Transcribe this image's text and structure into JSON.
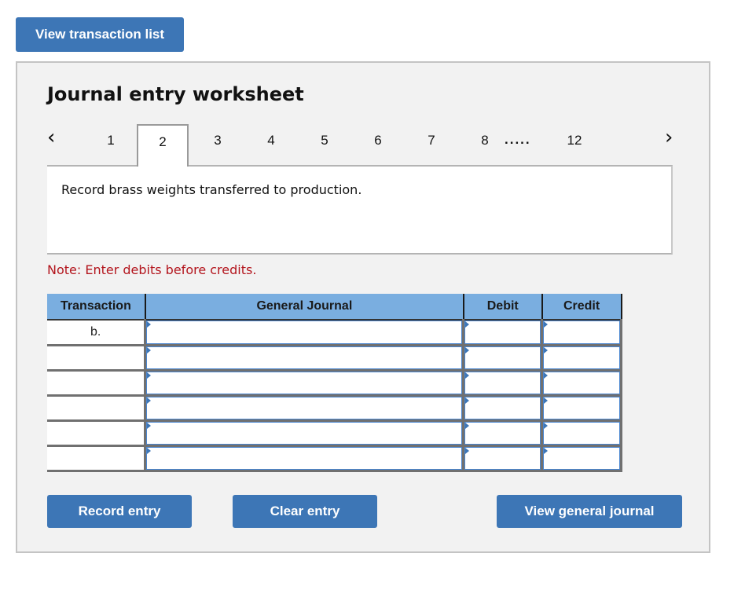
{
  "header": {
    "view_transaction_list_label": "View transaction list"
  },
  "worksheet": {
    "title": "Journal entry worksheet",
    "nav": {
      "prev_icon": "chevron-left-icon",
      "next_icon": "chevron-right-icon",
      "tabs": [
        {
          "label": "1",
          "active": false
        },
        {
          "label": "2",
          "active": true
        },
        {
          "label": "3",
          "active": false
        },
        {
          "label": "4",
          "active": false
        },
        {
          "label": "5",
          "active": false
        },
        {
          "label": "6",
          "active": false
        },
        {
          "label": "7",
          "active": false
        },
        {
          "label": "8",
          "active": false
        },
        {
          "label": "12",
          "active": false
        }
      ],
      "ellipsis": "....."
    },
    "description": "Record brass weights transferred to production.",
    "note": "Note: Enter debits before credits.",
    "note_color": "#b3141c",
    "table": {
      "headers": [
        "Transaction",
        "General Journal",
        "Debit",
        "Credit"
      ],
      "rows": [
        {
          "transaction": "b.",
          "account": "",
          "debit": "",
          "credit": ""
        },
        {
          "transaction": "",
          "account": "",
          "debit": "",
          "credit": ""
        },
        {
          "transaction": "",
          "account": "",
          "debit": "",
          "credit": ""
        },
        {
          "transaction": "",
          "account": "",
          "debit": "",
          "credit": ""
        },
        {
          "transaction": "",
          "account": "",
          "debit": "",
          "credit": ""
        },
        {
          "transaction": "",
          "account": "",
          "debit": "",
          "credit": ""
        }
      ]
    },
    "buttons": {
      "record": "Record entry",
      "clear": "Clear entry",
      "view_general_journal": "View general journal"
    }
  },
  "colors": {
    "button_blue": "#3d76b6",
    "header_blue": "#7aaee0",
    "panel_bg": "#f2f2f2"
  }
}
